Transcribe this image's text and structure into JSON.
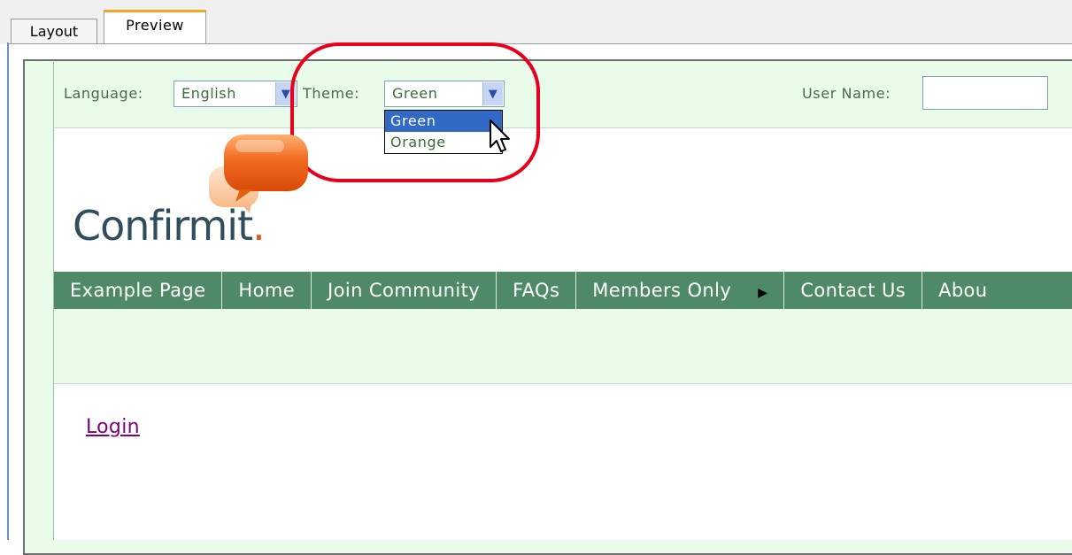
{
  "tabs": [
    {
      "label": "Layout",
      "active": false
    },
    {
      "label": "Preview",
      "active": true
    }
  ],
  "topbar": {
    "language_label": "Language:",
    "language_value": "English",
    "theme_label": "Theme:",
    "theme_value": "Green",
    "theme_options": [
      "Green",
      "Orange"
    ],
    "user_name_label": "User Name:",
    "user_name_value": ""
  },
  "logo": {
    "text": "Confirmit",
    "dot": "."
  },
  "nav": {
    "items": [
      "Example Page",
      "Home",
      "Join Community",
      "FAQs",
      "Members Only",
      "Contact Us",
      "Abou"
    ],
    "submenu_icon": "triangle-right-icon"
  },
  "content": {
    "login_link": "Login"
  },
  "colors": {
    "accent_red": "#e8001c",
    "nav_green": "#4f8a67",
    "band_green": "#e9fbe9",
    "selected_blue": "#3169c6"
  }
}
